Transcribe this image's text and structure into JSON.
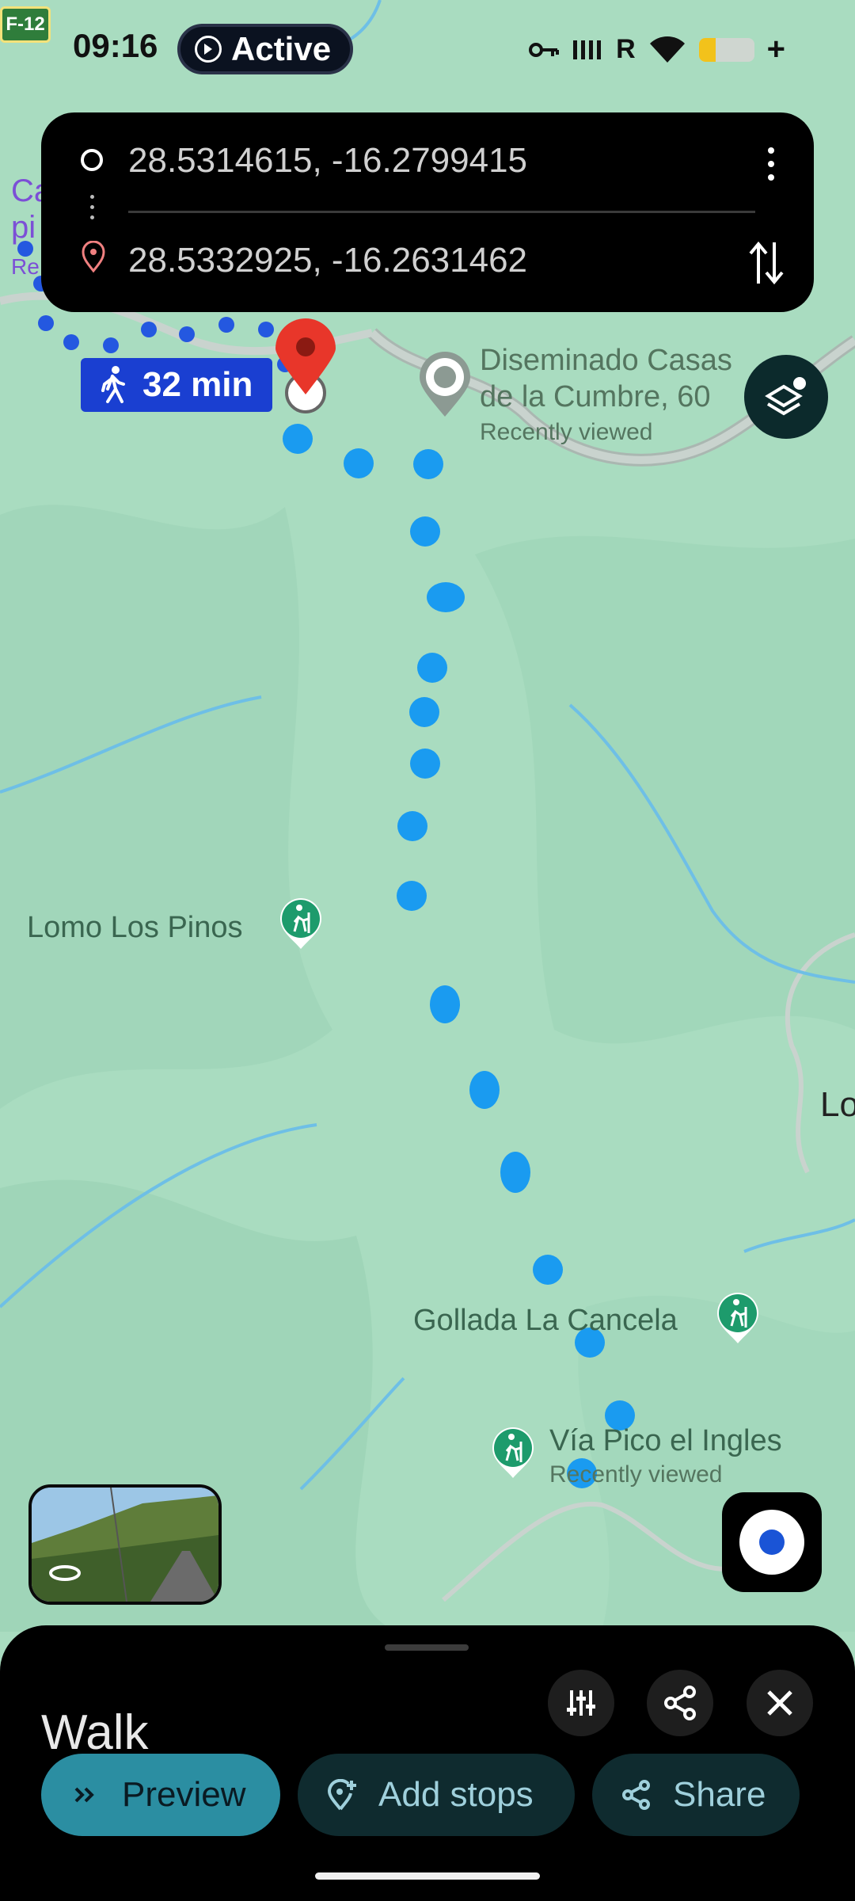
{
  "status_bar": {
    "time": "09:16",
    "active_label": "Active",
    "road_tag": "F-12",
    "signal_label": "R",
    "battery_level_pct": 30,
    "icons": [
      "vpn-key-icon",
      "signal-icon",
      "wifi-icon",
      "battery-icon"
    ]
  },
  "route_card": {
    "origin": "28.5314615, -16.2799415",
    "destination": "28.5332925, -16.2631462",
    "icons": [
      "origin-circle-icon",
      "destination-pin-icon",
      "more-vert-icon",
      "swap-icon"
    ]
  },
  "map": {
    "walk_time": "32 min",
    "labels": {
      "place_1": "Diseminado Casas",
      "place_1b": "de la Cumbre, 60",
      "place_1_sub": "Recently viewed",
      "poi_1": "Lomo Los Pinos",
      "poi_2": "Gollada La Cancela",
      "poi_3": "Vía Pico el Ingles",
      "poi_3_sub": "Recently viewed",
      "edge_left_1": "Ca",
      "edge_left_2": "pi",
      "edge_left_3": "Re",
      "edge_right": "Lo"
    },
    "colors": {
      "terrain": "#a9dcc0",
      "route_dots": "#1a9bf0",
      "route_dots_dark": "#2458e0",
      "destination_pin": "#e8362a",
      "poi_green": "#1d9b6c"
    }
  },
  "bottom_sheet": {
    "mode_title": "Walk",
    "buttons": {
      "preview": "Preview",
      "add_stops": "Add stops",
      "share": "Share"
    },
    "icons": [
      "tune-icon",
      "share-icon",
      "close-icon"
    ]
  }
}
